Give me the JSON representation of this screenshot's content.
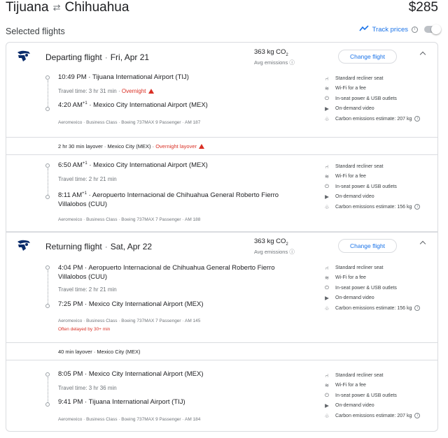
{
  "header": {
    "origin": "Tijuana",
    "destination": "Chihuahua",
    "price": "$285"
  },
  "selected_label": "Selected flights",
  "track_prices": {
    "label": "Track prices",
    "enabled": false
  },
  "departing": {
    "title": "Departing flight",
    "date": "Fri, Apr 21",
    "co2": "363 kg CO",
    "co2_sub": "2",
    "co2_note": "Avg emissions",
    "change_label": "Change flight",
    "legs": [
      {
        "depart_time": "10:49 PM",
        "depart_airport": "Tijuana International Airport (TIJ)",
        "travel_time": "Travel time: 3 hr 31 min",
        "travel_flag": "Overnight",
        "arrive_time": "4:20 AM",
        "arrive_sup": "+1",
        "arrive_airport": "Mexico City International Airport (MEX)",
        "meta": "Aeromexico · Business Class · Boeing 737MAX 9 Passenger · AM 187",
        "carbon": "Carbon emissions estimate: 207 kg"
      },
      {
        "depart_time": "6:50 AM",
        "depart_sup": "+1",
        "depart_airport": "Mexico City International Airport (MEX)",
        "travel_time": "Travel time: 2 hr 21 min",
        "arrive_time": "8:11 AM",
        "arrive_sup": "+1",
        "arrive_airport": "Aeropuerto Internacional de Chihuahua General Roberto Fierro Villalobos (CUU)",
        "meta": "Aeromexico · Business Class · Boeing 737MAX 7 Passenger · AM 188",
        "carbon": "Carbon emissions estimate: 156 kg"
      }
    ],
    "layover": "2 hr 30 min layover · Mexico City (MEX)",
    "layover_flag": "Overnight layover"
  },
  "returning": {
    "title": "Returning flight",
    "date": "Sat, Apr 22",
    "co2": "363 kg CO",
    "co2_sub": "2",
    "co2_note": "Avg emissions",
    "change_label": "Change flight",
    "legs": [
      {
        "depart_time": "4:04 PM",
        "depart_airport": "Aeropuerto Internacional de Chihuahua General Roberto Fierro Villalobos (CUU)",
        "travel_time": "Travel time: 2 hr 21 min",
        "arrive_time": "7:25 PM",
        "arrive_airport": "Mexico City International Airport (MEX)",
        "meta": "Aeromexico · Business Class · Boeing 737MAX 7 Passenger · AM 145",
        "delay": "Often delayed by 30+ min",
        "carbon": "Carbon emissions estimate: 156 kg"
      },
      {
        "depart_time": "8:05 PM",
        "depart_airport": "Mexico City International Airport (MEX)",
        "travel_time": "Travel time: 3 hr 36 min",
        "arrive_time": "9:41 PM",
        "arrive_airport": "Tijuana International Airport (TIJ)",
        "meta": "Aeromexico · Business Class · Boeing 737MAX 9 Passenger · AM 184",
        "carbon": "Carbon emissions estimate: 207 kg"
      }
    ],
    "layover": "40 min layover · Mexico City (MEX)"
  },
  "amenities": {
    "seat": "Standard recliner seat",
    "wifi": "Wi-Fi for a fee",
    "power": "In-seat power & USB outlets",
    "video": "On-demand video"
  },
  "colors": {
    "accent": "#1a73e8",
    "warning": "#d93025",
    "border": "#dadce0"
  }
}
